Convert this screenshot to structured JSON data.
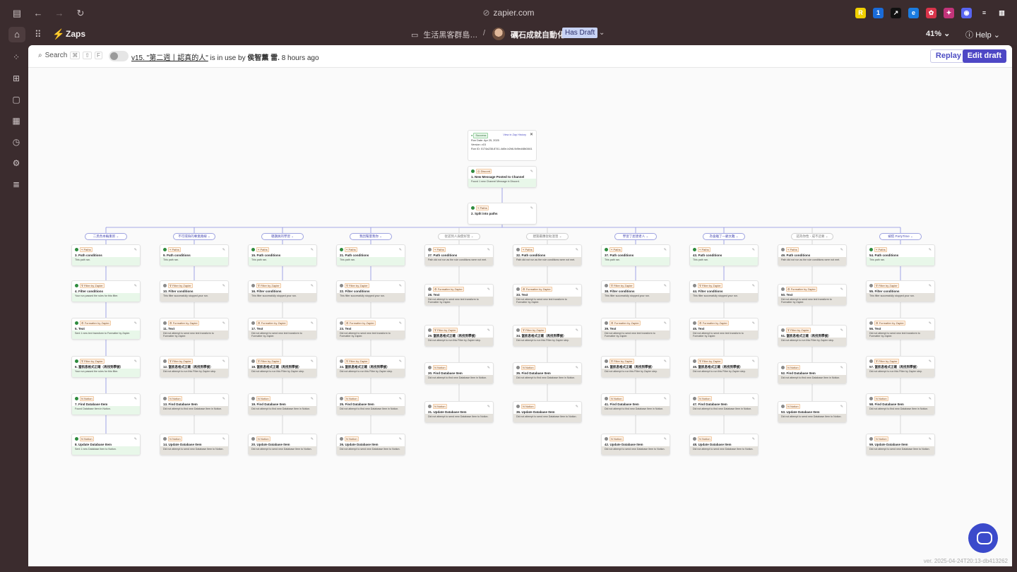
{
  "browser": {
    "url": "zapier.com",
    "extensions": [
      {
        "name": "r-extension-icon",
        "glyph": "R",
        "color": "#f0d000"
      },
      {
        "name": "onepassword-icon",
        "glyph": "1",
        "color": "#1a6bd8"
      },
      {
        "name": "send-extension-icon",
        "glyph": "↗",
        "color": "#111111"
      },
      {
        "name": "edge-extension-icon",
        "glyph": "e",
        "color": "#1b7ce0"
      },
      {
        "name": "red-extension-icon",
        "glyph": "✿",
        "color": "#d8344a"
      },
      {
        "name": "pink-extension-icon",
        "glyph": "✦",
        "color": "#c2347a"
      },
      {
        "name": "discord-extension-icon",
        "glyph": "◉",
        "color": "#5865f2"
      },
      {
        "name": "reader-icon",
        "glyph": "≡",
        "color": "#3b2c2e"
      },
      {
        "name": "sidebar-right-icon",
        "glyph": "▥",
        "color": "#3b2c2e"
      }
    ]
  },
  "app": {
    "name": "Zaps",
    "folder": "生活黑客群島…",
    "zap_title": "礪石成就自動化",
    "draft_badge": "Has Draft",
    "zoom": "41%",
    "help": "Help"
  },
  "toolbar": {
    "search": "Search",
    "shortcut_keys": [
      "⌘",
      "⇧",
      "F"
    ],
    "version_link": "v15. \"第二週丨認真的人\"",
    "in_use_text": " is in use by ",
    "user": "侯智薰 雷.",
    "time_ago": " 8 hours ago",
    "replay": "Replay",
    "edit_draft": "Edit draft"
  },
  "run_info": {
    "status": "Success",
    "view_link": "View in Zap History",
    "run_date": "Run Date: Apr 25, 2025",
    "version": "Version: v15",
    "run_id": "Run ID: 0174a238-8741-4d0e-b2b6-9d9ed48b3461"
  },
  "trigger": {
    "app": "Discord",
    "badge": "2 min",
    "title": "1. New Message Posted to Channel",
    "msg": "Found 1 new Channel Message in Discord.",
    "ok": true
  },
  "split": {
    "app": "Paths",
    "title": "2. Split into paths",
    "msg": "",
    "ok": true
  },
  "branches": [
    {
      "label": "二黑色本輪重新",
      "active": true,
      "steps": [
        {
          "app": "Paths",
          "title": "3. Path conditions",
          "msg": "This path ran.",
          "ok": true
        },
        {
          "app": "Filter by Zapier",
          "title": "4. Filter conditions",
          "msg": "Your run passed the rules for this filter.",
          "ok": true
        },
        {
          "app": "Formatter by Zapier",
          "title": "5. Text",
          "msg": "Sent 1 new text transform to Formatter by Zapier.",
          "ok": true
        },
        {
          "app": "Filter by Zapier",
          "title": "6. 當訊息格式正確（再找到學號）",
          "msg": "Your run passed the rules for this filter.",
          "ok": true
        },
        {
          "app": "Notion",
          "title": "7. Find Database Item",
          "msg": "Found Database Item in Notion.",
          "ok": true
        },
        {
          "app": "Notion",
          "title": "8. Update Database Item",
          "msg": "Sent 1 new Database Item to Notion.",
          "ok": true
        }
      ]
    },
    {
      "label": "不可或缺的專業路線",
      "active": true,
      "steps": [
        {
          "app": "Paths",
          "title": "9. Path conditions",
          "msg": "This path ran.",
          "ok": true
        },
        {
          "app": "Filter by Zapier",
          "title": "10. Filter conditions",
          "msg": "This filter successfully stopped your run.",
          "ok": false
        },
        {
          "app": "Formatter by Zapier",
          "title": "11. Text",
          "msg": "Did not attempt to send new text transform to Formatter by Zapier.",
          "ok": false
        },
        {
          "app": "Filter by Zapier",
          "title": "12. 當訊息格式正確（再找到學號）",
          "msg": "Did not attempt to run this Filter by Zapier step.",
          "ok": false
        },
        {
          "app": "Notion",
          "title": "13. Find Database Item",
          "msg": "Did not attempt to find new Database Item in Notion.",
          "ok": false
        },
        {
          "app": "Notion",
          "title": "14. Update Database Item",
          "msg": "Did not attempt to send new Database Item to Notion.",
          "ok": false
        }
      ]
    },
    {
      "label": "聰讚員的學習",
      "active": true,
      "steps": [
        {
          "app": "Paths",
          "title": "15. Path conditions",
          "msg": "This path ran.",
          "ok": true
        },
        {
          "app": "Filter by Zapier",
          "title": "16. Filter conditions",
          "msg": "This filter successfully stopped your run.",
          "ok": false
        },
        {
          "app": "Formatter by Zapier",
          "title": "17. Text",
          "msg": "Did not attempt to send new text transform to Formatter by Zapier.",
          "ok": false
        },
        {
          "app": "Filter by Zapier",
          "title": "18. 當訊息格式正確（再找到學號）",
          "msg": "Did not attempt to run this Filter by Zapier step.",
          "ok": false
        },
        {
          "app": "Notion",
          "title": "19. Find Database Item",
          "msg": "Did not attempt to find new Database Item in Notion.",
          "ok": false
        },
        {
          "app": "Notion",
          "title": "20. Update Database Item",
          "msg": "Did not attempt to send new Database Item to Notion.",
          "ok": false
        }
      ]
    },
    {
      "label": "我因幫量我你",
      "active": true,
      "steps": [
        {
          "app": "Paths",
          "title": "21. Path conditions",
          "msg": "This path ran.",
          "ok": true
        },
        {
          "app": "Filter by Zapier",
          "title": "22. Filter conditions",
          "msg": "This filter successfully stopped your run.",
          "ok": false
        },
        {
          "app": "Formatter by Zapier",
          "title": "23. Text",
          "msg": "Did not attempt to send new text transform to Formatter by Zapier.",
          "ok": false
        },
        {
          "app": "Filter by Zapier",
          "title": "24. 當訊息格式正確（再找到學號）",
          "msg": "Did not attempt to run this Filter by Zapier step.",
          "ok": false
        },
        {
          "app": "Notion",
          "title": "25. Find Database Item",
          "msg": "Did not attempt to find new Database Item in Notion.",
          "ok": false
        },
        {
          "app": "Notion",
          "title": "26. Update Database Item",
          "msg": "Did not attempt to send new Database Item to Notion.",
          "ok": false
        }
      ]
    },
    {
      "label": "從認到人與使好習",
      "active": false,
      "steps": [
        {
          "app": "Paths",
          "title": "27. Path conditions",
          "msg": "Path did not run as the rule conditions were not met.",
          "ok": false
        },
        {
          "app": "Formatter by Zapier",
          "title": "28. Text",
          "msg": "Did not attempt to send new text transform to Formatter by Zapier.",
          "ok": false
        },
        {
          "app": "Filter by Zapier",
          "title": "29. 當訊息格式正確（再找到學號）",
          "msg": "Did not attempt to run this Filter by Zapier step.",
          "ok": false
        },
        {
          "app": "Notion",
          "title": "30. Find Database Item",
          "msg": "Did not attempt to find new Database Item in Notion.",
          "ok": false
        },
        {
          "app": "Notion",
          "title": "31. Update Database Item",
          "msg": "Did not attempt to send new Database Item to Notion.",
          "ok": false
        }
      ]
    },
    {
      "label": "建築最應從助溫習",
      "active": false,
      "steps": [
        {
          "app": "Paths",
          "title": "32. Path conditions",
          "msg": "Path did not run as the rule conditions were not met.",
          "ok": false
        },
        {
          "app": "Formatter by Zapier",
          "title": "33. Text",
          "msg": "Did not attempt to send new text transform to Formatter by Zapier.",
          "ok": false
        },
        {
          "app": "Filter by Zapier",
          "title": "34. 當訊息格式正確（再找到學號）",
          "msg": "Did not attempt to run this Filter by Zapier step.",
          "ok": false
        },
        {
          "app": "Notion",
          "title": "35. Find Database Item",
          "msg": "Did not attempt to find new Database Item in Notion.",
          "ok": false
        },
        {
          "app": "Notion",
          "title": "36. Update Database Item",
          "msg": "Did not attempt to send new Database Item to Notion.",
          "ok": false
        }
      ]
    },
    {
      "label": "學習了屋建者人",
      "active": true,
      "steps": [
        {
          "app": "Paths",
          "title": "37. Path conditions",
          "msg": "This path ran.",
          "ok": true
        },
        {
          "app": "Filter by Zapier",
          "title": "38. Filter conditions",
          "msg": "This filter successfully stopped your run.",
          "ok": false
        },
        {
          "app": "Formatter by Zapier",
          "title": "39. Text",
          "msg": "Did not attempt to send new text transform to Formatter by Zapier.",
          "ok": false
        },
        {
          "app": "Filter by Zapier",
          "title": "40. 當訊息格式正確（再找到學號）",
          "msg": "Did not attempt to run this Filter by Zapier step.",
          "ok": false
        },
        {
          "app": "Notion",
          "title": "41. Find Database Item",
          "msg": "Did not attempt to find new Database Item in Notion.",
          "ok": false
        },
        {
          "app": "Notion",
          "title": "42. Update Database Item",
          "msg": "Did not attempt to send new Database Item to Notion.",
          "ok": false
        }
      ]
    },
    {
      "label": "為會離了一顧太難",
      "active": true,
      "steps": [
        {
          "app": "Paths",
          "title": "43. Path conditions",
          "msg": "This path ran.",
          "ok": true
        },
        {
          "app": "Filter by Zapier",
          "title": "44. Filter conditions",
          "msg": "This filter successfully stopped your run.",
          "ok": false
        },
        {
          "app": "Formatter by Zapier",
          "title": "45. Text",
          "msg": "Did not attempt to send new text transform to Formatter by Zapier.",
          "ok": false
        },
        {
          "app": "Filter by Zapier",
          "title": "46. 當訊息格式正確（再找到學號）",
          "msg": "Did not attempt to run this Filter by Zapier step.",
          "ok": false
        },
        {
          "app": "Notion",
          "title": "47. Find Database Item",
          "msg": "Did not attempt to find new Database Item in Notion.",
          "ok": false
        },
        {
          "app": "Notion",
          "title": "48. Update Database Item",
          "msg": "Did not attempt to send new Database Item to Notion.",
          "ok": false
        }
      ]
    },
    {
      "label": "認為你性 - 成不這要",
      "active": false,
      "steps": [
        {
          "app": "Paths",
          "title": "49. Path conditions",
          "msg": "Path did not run as the rule conditions were not met.",
          "ok": false
        },
        {
          "app": "Formatter by Zapier",
          "title": "50. Text",
          "msg": "Did not attempt to send new text transform to Formatter by Zapier.",
          "ok": false
        },
        {
          "app": "Filter by Zapier",
          "title": "51. 當訊息格式正確（再找到學號）",
          "msg": "Did not attempt to run this Filter by Zapier step.",
          "ok": false
        },
        {
          "app": "Notion",
          "title": "52. Find Database Item",
          "msg": "Did not attempt to find new Database Item in Notion.",
          "ok": false
        },
        {
          "app": "Notion",
          "title": "53. Update Database Item",
          "msg": "Did not attempt to send new Database Item to Notion.",
          "ok": false
        }
      ]
    },
    {
      "label": "被搭 PartyTime",
      "active": true,
      "steps": [
        {
          "app": "Paths",
          "title": "54. Path conditions",
          "msg": "This path ran.",
          "ok": true
        },
        {
          "app": "Filter by Zapier",
          "title": "55. Filter conditions",
          "msg": "This filter successfully stopped your run.",
          "ok": false
        },
        {
          "app": "Formatter by Zapier",
          "title": "56. Text",
          "msg": "Did not attempt to send new text transform to Formatter by Zapier.",
          "ok": false
        },
        {
          "app": "Filter by Zapier",
          "title": "57. 當訊息格式正確（再找到學號）",
          "msg": "Did not attempt to run this Filter by Zapier step.",
          "ok": false
        },
        {
          "app": "Notion",
          "title": "58. Find Database Item",
          "msg": "Did not attempt to find new Database Item in Notion.",
          "ok": false
        },
        {
          "app": "Notion",
          "title": "59. Update Database Item",
          "msg": "Did not attempt to send new Database Item to Notion.",
          "ok": false
        }
      ]
    }
  ],
  "footer": {
    "version": "ver. 2025-04-24T20:13-db413262"
  }
}
